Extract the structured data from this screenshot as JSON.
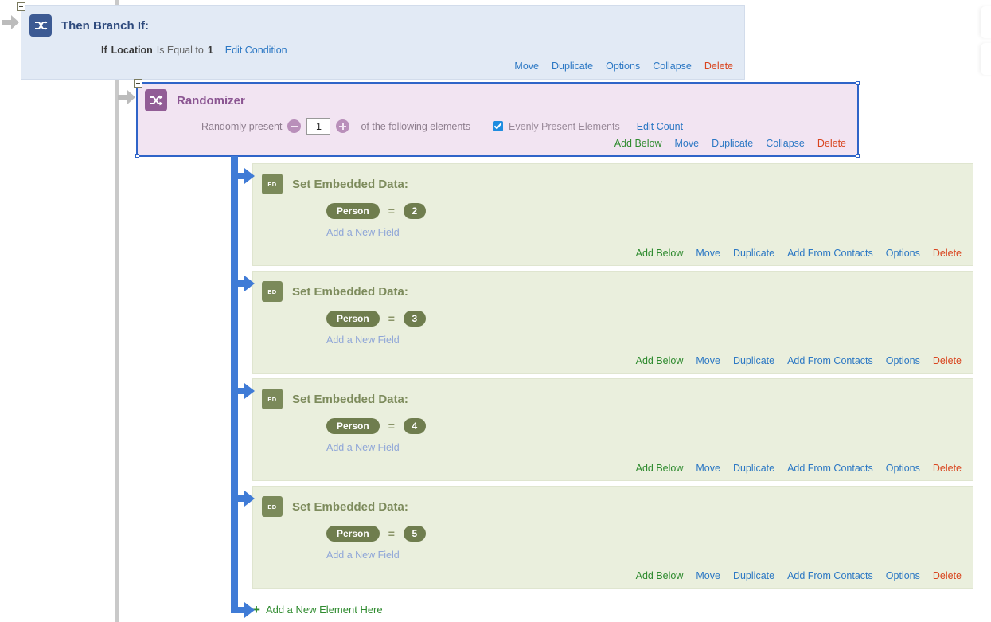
{
  "branch": {
    "title": "Then Branch If:",
    "icon": "branch-arrows-icon",
    "condition": {
      "if_label": "If",
      "field": "Location",
      "operator": "Is Equal to",
      "value": "1",
      "edit_link": "Edit Condition"
    },
    "actions": [
      {
        "label": "Move",
        "style": "blue"
      },
      {
        "label": "Duplicate",
        "style": "blue"
      },
      {
        "label": "Options",
        "style": "blue"
      },
      {
        "label": "Collapse",
        "style": "blue"
      },
      {
        "label": "Delete",
        "style": "red"
      }
    ]
  },
  "randomizer": {
    "title": "Randomizer",
    "icon": "shuffle-icon",
    "controls": {
      "prefix_label": "Randomly present",
      "decrement_label": "−",
      "count_value": "1",
      "increment_label": "+",
      "suffix_label": "of the following elements",
      "evenly_checkbox_checked": true,
      "evenly_label": "Evenly Present Elements",
      "edit_count_link": "Edit Count"
    },
    "actions": [
      {
        "label": "Add Below",
        "style": "green"
      },
      {
        "label": "Move",
        "style": "blue"
      },
      {
        "label": "Duplicate",
        "style": "blue"
      },
      {
        "label": "Collapse",
        "style": "blue"
      },
      {
        "label": "Delete",
        "style": "red"
      }
    ]
  },
  "embedded_data_blocks": [
    {
      "title": "Set Embedded Data:",
      "icon": "embedded-data-icon",
      "icon_text": "ED",
      "field_name": "Person",
      "equals": "=",
      "field_value": "2",
      "add_field_label": "Add a New Field",
      "actions": [
        {
          "label": "Add Below",
          "style": "green"
        },
        {
          "label": "Move",
          "style": "blue"
        },
        {
          "label": "Duplicate",
          "style": "blue"
        },
        {
          "label": "Add From Contacts",
          "style": "blue"
        },
        {
          "label": "Options",
          "style": "blue"
        },
        {
          "label": "Delete",
          "style": "red"
        }
      ]
    },
    {
      "title": "Set Embedded Data:",
      "icon": "embedded-data-icon",
      "icon_text": "ED",
      "field_name": "Person",
      "equals": "=",
      "field_value": "3",
      "add_field_label": "Add a New Field",
      "actions": [
        {
          "label": "Add Below",
          "style": "green"
        },
        {
          "label": "Move",
          "style": "blue"
        },
        {
          "label": "Duplicate",
          "style": "blue"
        },
        {
          "label": "Add From Contacts",
          "style": "blue"
        },
        {
          "label": "Options",
          "style": "blue"
        },
        {
          "label": "Delete",
          "style": "red"
        }
      ]
    },
    {
      "title": "Set Embedded Data:",
      "icon": "embedded-data-icon",
      "icon_text": "ED",
      "field_name": "Person",
      "equals": "=",
      "field_value": "4",
      "add_field_label": "Add a New Field",
      "actions": [
        {
          "label": "Add Below",
          "style": "green"
        },
        {
          "label": "Move",
          "style": "blue"
        },
        {
          "label": "Duplicate",
          "style": "blue"
        },
        {
          "label": "Add From Contacts",
          "style": "blue"
        },
        {
          "label": "Options",
          "style": "blue"
        },
        {
          "label": "Delete",
          "style": "red"
        }
      ]
    },
    {
      "title": "Set Embedded Data:",
      "icon": "embedded-data-icon",
      "icon_text": "ED",
      "field_name": "Person",
      "equals": "=",
      "field_value": "5",
      "add_field_label": "Add a New Field",
      "actions": [
        {
          "label": "Add Below",
          "style": "green"
        },
        {
          "label": "Move",
          "style": "blue"
        },
        {
          "label": "Duplicate",
          "style": "blue"
        },
        {
          "label": "Add From Contacts",
          "style": "blue"
        },
        {
          "label": "Options",
          "style": "blue"
        },
        {
          "label": "Delete",
          "style": "red"
        }
      ]
    }
  ],
  "footer": {
    "add_element_plus": "+",
    "add_element_label": "Add a New Element Here"
  },
  "colors": {
    "branch_bg": "#e2eaf5",
    "branch_icon": "#3c5a93",
    "randomizer_bg": "#f2e4f2",
    "randomizer_icon": "#925d96",
    "randomizer_border": "#2f64c8",
    "embedded_bg": "#eaefdd",
    "embedded_icon": "#7b8a5a",
    "connector_blue": "#3f7bd6",
    "link_blue": "#2c78c4",
    "link_green": "#2f8b2f",
    "link_red": "#d9451f"
  }
}
